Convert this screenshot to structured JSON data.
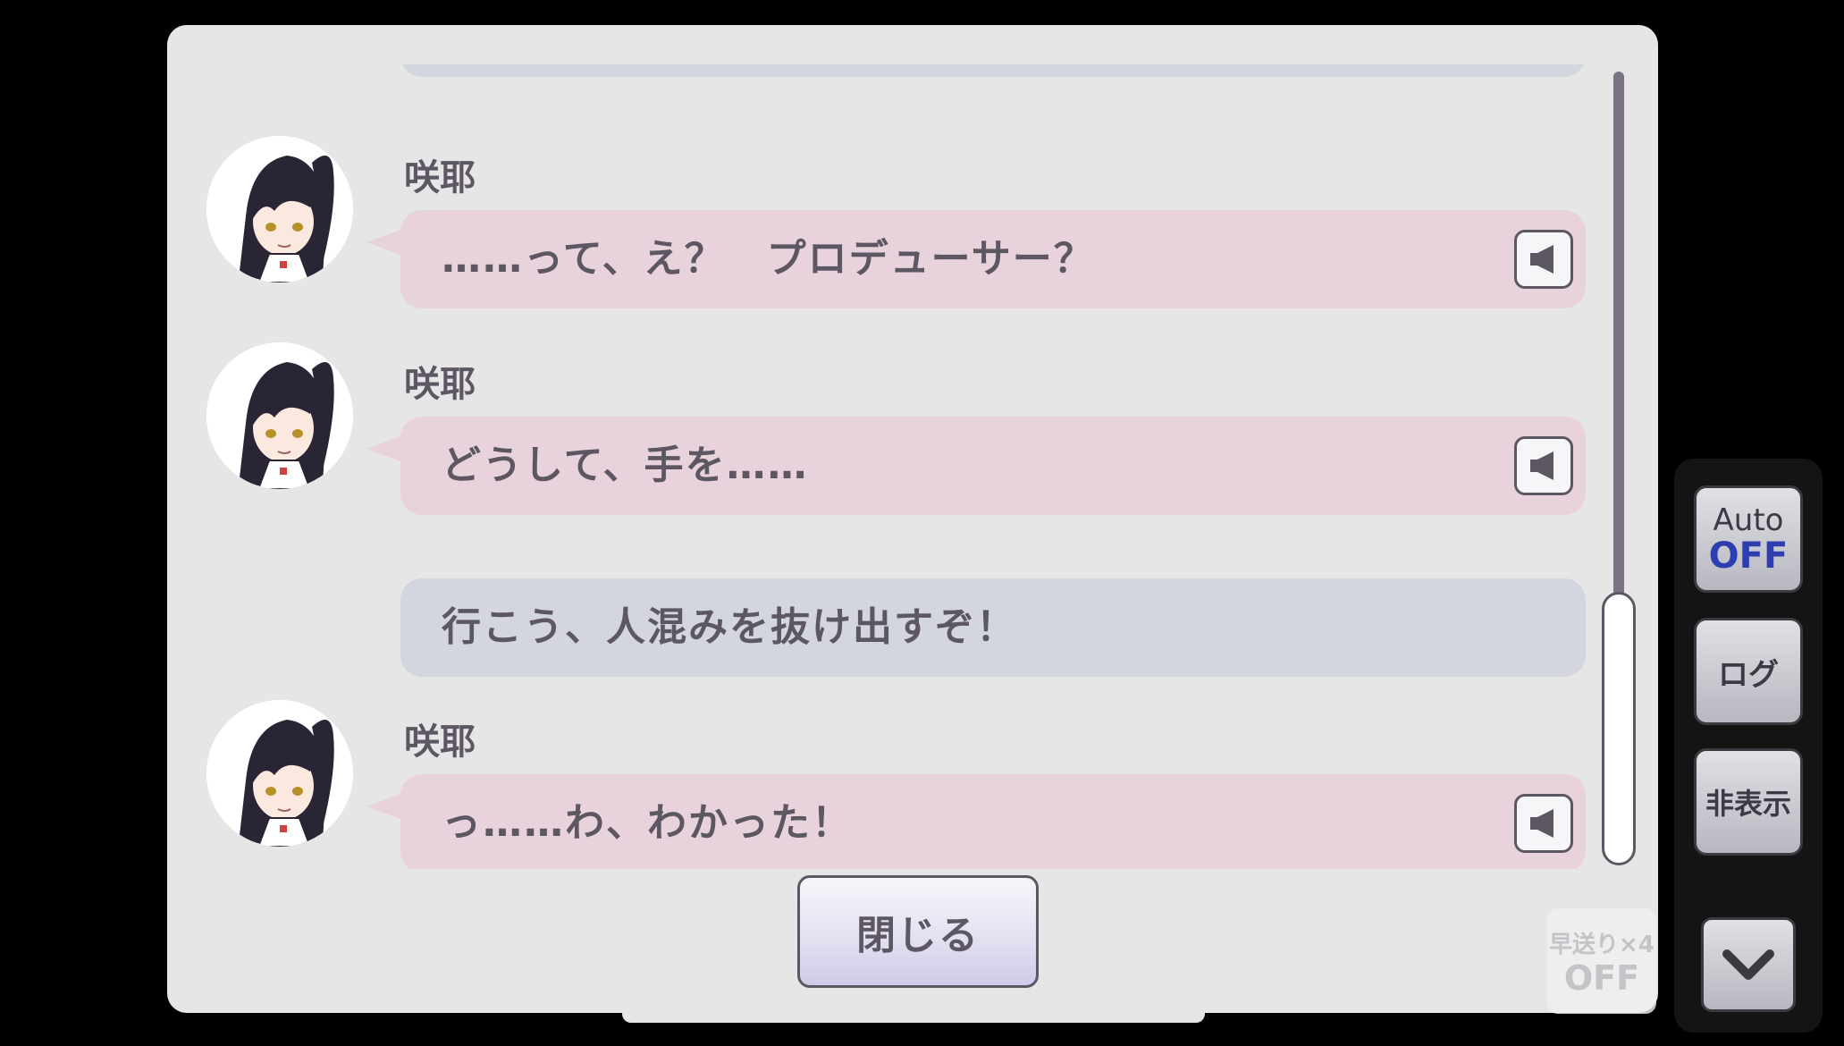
{
  "log": {
    "messages": [
      {
        "type": "character",
        "speaker": "咲耶",
        "text": "……って、え？　プロデューサー？"
      },
      {
        "type": "character",
        "speaker": "咲耶",
        "text": "どうして、手を……"
      },
      {
        "type": "narration",
        "text": "行こう、人混みを抜け出すぞ！"
      },
      {
        "type": "character",
        "speaker": "咲耶",
        "text": "っ……わ、わかった！"
      }
    ],
    "close_label": "閉じる"
  },
  "side_menu": {
    "auto_label": "Auto",
    "auto_state": "OFF",
    "log_label": "ログ",
    "hide_label": "非表示"
  },
  "fast_forward": {
    "label": "早送り×4",
    "state": "OFF"
  },
  "colors": {
    "background": "#000000",
    "panel": "#e6e6e6",
    "character_bubble": "#e8d3dd",
    "narration_bubble": "#d3d6de",
    "text": "#5d5663",
    "auto_off": "#2d3fb0"
  }
}
